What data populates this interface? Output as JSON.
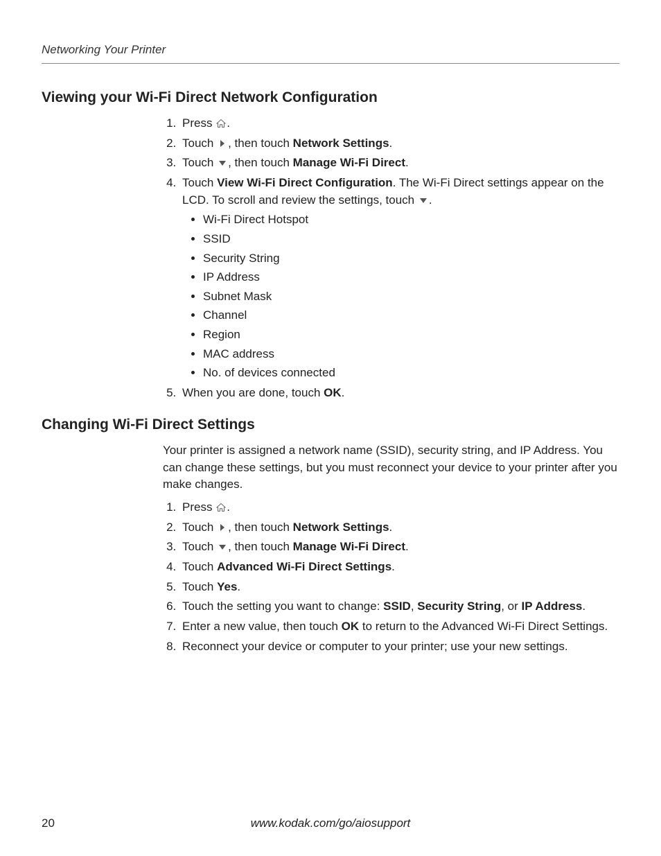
{
  "runningHead": "Networking Your Printer",
  "section1": {
    "title": "Viewing your Wi-Fi Direct Network Configuration",
    "s1": {
      "pre": "Press ",
      "post": "."
    },
    "s2": {
      "pre": "Touch ",
      "mid": ", then touch ",
      "bold": "Network Settings",
      "post": "."
    },
    "s3": {
      "pre": "Touch ",
      "mid": ", then touch ",
      "bold": "Manage Wi-Fi Direct",
      "post": "."
    },
    "s4": {
      "pre": "Touch ",
      "bold": "View Wi-Fi Direct Configuration",
      "mid": ". The Wi-Fi Direct settings appear on the LCD. To scroll and review the settings, touch ",
      "post": ".",
      "bullets": [
        "Wi-Fi Direct Hotspot",
        "SSID",
        "Security String",
        "IP Address",
        "Subnet Mask",
        "Channel",
        "Region",
        "MAC address",
        "No. of devices connected"
      ]
    },
    "s5": {
      "pre": "When you are done, touch ",
      "bold": "OK",
      "post": "."
    }
  },
  "section2": {
    "title": "Changing Wi-Fi Direct Settings",
    "intro": "Your printer is assigned a network name (SSID), security string, and IP Address. You can change these settings, but you must reconnect your device to your printer after you make changes.",
    "s1": {
      "pre": "Press ",
      "post": "."
    },
    "s2": {
      "pre": "Touch ",
      "mid": ", then touch ",
      "bold": "Network Settings",
      "post": "."
    },
    "s3": {
      "pre": "Touch ",
      "mid": ", then touch ",
      "bold": "Manage Wi-Fi Direct",
      "post": "."
    },
    "s4": {
      "pre": "Touch ",
      "bold": "Advanced Wi-Fi Direct Settings",
      "post": "."
    },
    "s5": {
      "pre": "Touch ",
      "bold": "Yes",
      "post": "."
    },
    "s6": {
      "pre": "Touch the setting you want to change: ",
      "b1": "SSID",
      "c1": ", ",
      "b2": "Security String",
      "c2": ", or ",
      "b3": "IP Address",
      "post": "."
    },
    "s7": {
      "pre": "Enter a new value, then touch ",
      "bold": "OK",
      "post": " to return to the Advanced Wi-Fi Direct Settings."
    },
    "s8": {
      "text": "Reconnect your device or computer to your printer; use your new settings."
    }
  },
  "footer": {
    "page": "20",
    "url": "www.kodak.com/go/aiosupport"
  }
}
